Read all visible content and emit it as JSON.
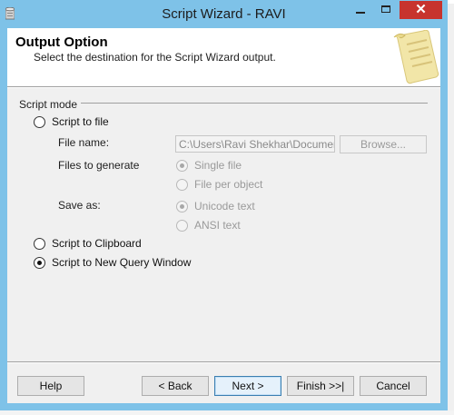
{
  "window": {
    "title": "Script Wizard - RAVI",
    "close_glyph": "✕"
  },
  "header": {
    "title": "Output Option",
    "subtitle": "Select the destination for the Script Wizard output."
  },
  "script_mode": {
    "group_label": "Script mode",
    "options": [
      {
        "label": "Script to file",
        "checked": false
      },
      {
        "label": "Script to Clipboard",
        "checked": false
      },
      {
        "label": "Script to New Query Window",
        "checked": true
      }
    ],
    "file_name_label": "File name:",
    "file_name_value": "C:\\Users\\Ravi Shekhar\\Documents",
    "browse_label": "Browse...",
    "files_to_generate_label": "Files to generate",
    "files_to_generate_options": [
      {
        "label": "Single file",
        "checked": true
      },
      {
        "label": "File per object",
        "checked": false
      }
    ],
    "save_as_label": "Save as:",
    "save_as_options": [
      {
        "label": "Unicode text",
        "checked": true
      },
      {
        "label": "ANSI text",
        "checked": false
      }
    ]
  },
  "buttons": {
    "help": "Help",
    "back": "< Back",
    "next": "Next >",
    "finish": "Finish >>|",
    "cancel": "Cancel"
  },
  "icons": {
    "app": "database-icon",
    "header_graphic": "scroll-icon"
  }
}
